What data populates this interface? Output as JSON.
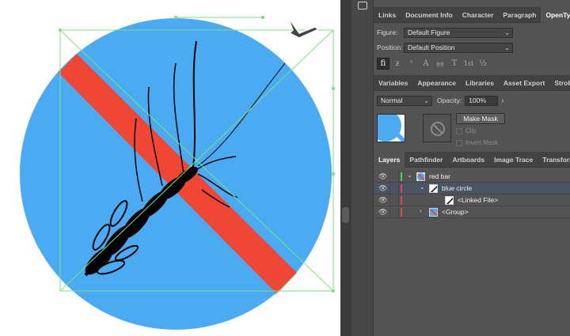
{
  "colors": {
    "circle": "#4aabf3",
    "bar": "#ef4733",
    "guides": "#7ee07e",
    "panel_bg": "#535353",
    "selection_row": "#4a5463"
  },
  "panel_tabs_top": [
    "Links",
    "Document Info",
    "Character",
    "Paragraph",
    "OpenType"
  ],
  "opentype": {
    "figure_label": "Figure:",
    "figure_value": "Default Figure",
    "position_label": "Position:",
    "position_value": "Default Position",
    "glyph_buttons": [
      "fi",
      "ƶ",
      "ᵋ",
      "A",
      "a̲a̲",
      "T",
      "1st",
      "½"
    ]
  },
  "panel_tabs_mid": [
    "Variables",
    "Appearance",
    "Libraries",
    "Asset Export",
    "Stroke"
  ],
  "transparency": {
    "blend_mode": "Normal",
    "opacity_label": "Opacity:",
    "opacity_value": "100%",
    "make_mask": "Make Mask",
    "clip": "Clip",
    "invert_mask": "Invert Mask"
  },
  "panel_tabs_bottom": [
    "Layers",
    "Pathfinder",
    "Artboards",
    "Image Trace",
    "Transform"
  ],
  "layers": [
    {
      "name": "red bar",
      "icon": "eye-icon",
      "expanded": true
    },
    {
      "name": "blue circle",
      "icon": "eye-icon",
      "expanded": true
    },
    {
      "name": "<Linked File>",
      "icon": "eye-icon",
      "expanded": false
    },
    {
      "name": "<Group>",
      "icon": "eye-icon",
      "expanded": false
    }
  ]
}
